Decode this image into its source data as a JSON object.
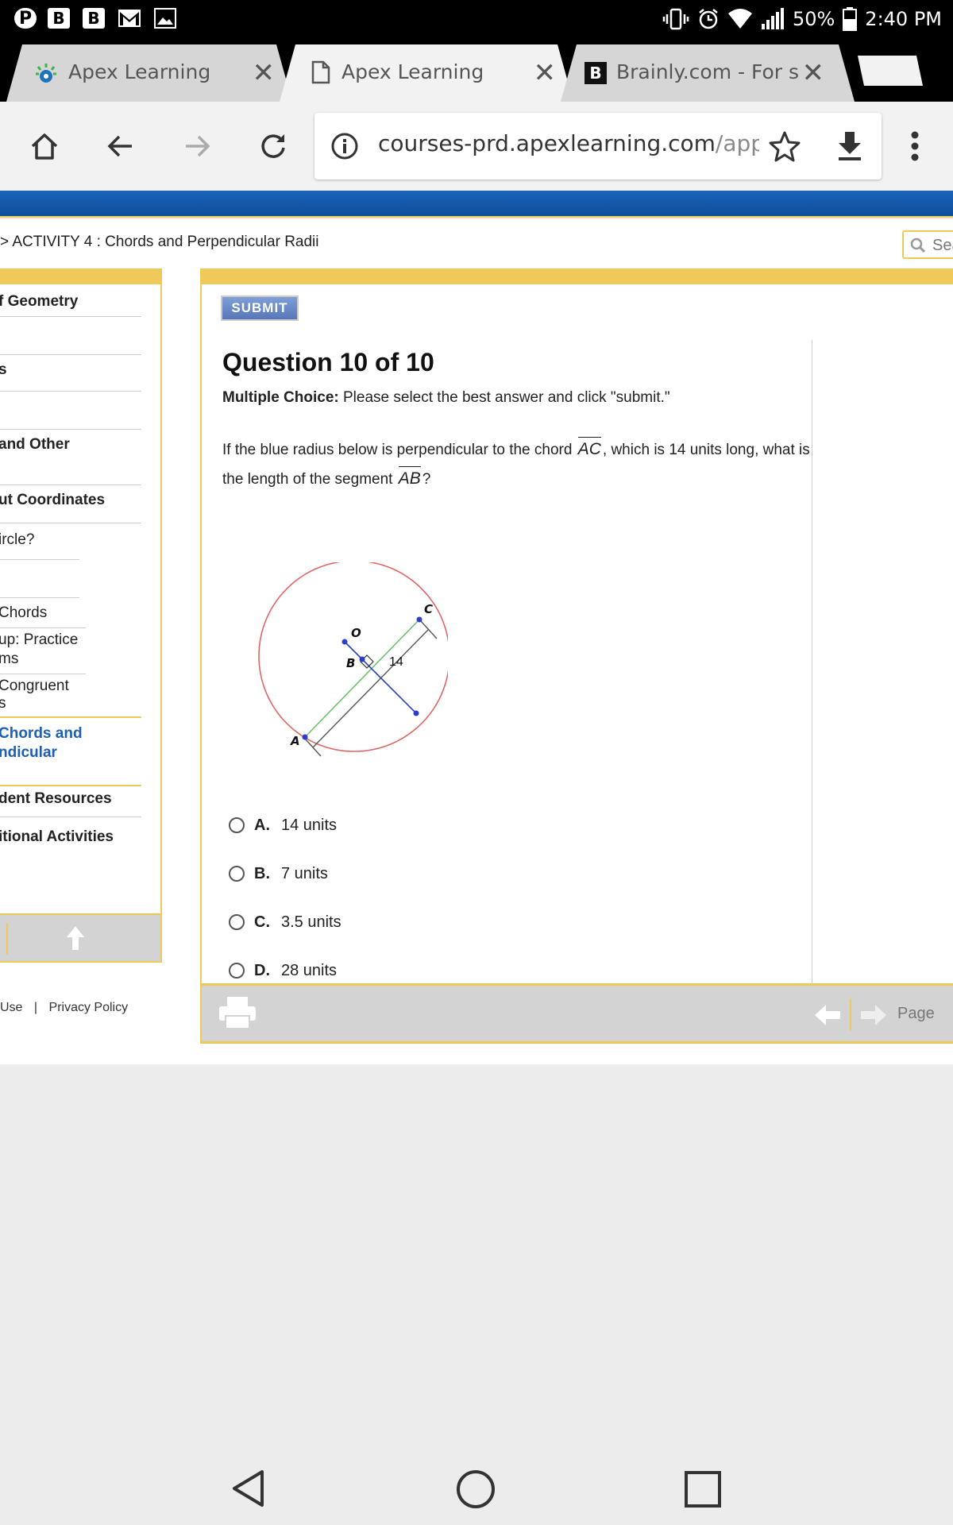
{
  "status_bar": {
    "notification_icons": [
      "pinterest-icon",
      "brainly-icon",
      "brainly-icon",
      "gmail-icon",
      "gallery-icon"
    ],
    "notif_b1": "B",
    "notif_b2": "B",
    "battery": "50%",
    "time": "2:40 PM"
  },
  "tabs": [
    {
      "label": "Apex Learning",
      "active": false
    },
    {
      "label": "Apex Learning",
      "active": true
    },
    {
      "label": "Brainly.com - For s",
      "active": false
    }
  ],
  "toolbar": {
    "url_host": "courses-prd.apexlearning.com",
    "url_path": "/apps."
  },
  "breadcrumb": "> ACTIVITY 4 : Chords and Perpendicular Radii",
  "search_placeholder": "Sea",
  "left_nav": {
    "items": [
      "f Geometry",
      "s",
      " and Other",
      "ut Coordinates",
      "ircle?",
      "Chords",
      "up: Practice",
      "ms",
      "Congruent",
      "s",
      "Chords and",
      "ndicular",
      "dent Resources",
      "itional Activities"
    ]
  },
  "footer_links": {
    "use": "Use",
    "separator": "|",
    "privacy": "Privacy Policy"
  },
  "question": {
    "submit_label": "SUBMIT",
    "title": "Question 10 of 10",
    "instruction_bold": "Multiple Choice:",
    "instruction_rest": " Please select the best answer and click \"submit.\"",
    "text_part1": "If the blue radius below is perpendicular to the chord ",
    "seg1": "AC",
    "text_part2": ", which is 14 units long, what is the length of the segment ",
    "seg2": "AB",
    "text_part3": "?",
    "diagram": {
      "label_a": "A",
      "label_b": "B",
      "label_c": "C",
      "label_o": "O",
      "length_label": "14"
    },
    "choices": [
      {
        "letter": "A.",
        "text": "14 units"
      },
      {
        "letter": "B.",
        "text": "7 units"
      },
      {
        "letter": "C.",
        "text": "3.5 units"
      },
      {
        "letter": "D.",
        "text": "28 units"
      }
    ]
  },
  "bottom_bar": {
    "page_label": "Page"
  },
  "colors": {
    "accent_yellow": "#f0c95b",
    "header_blue": "#1a64b8",
    "active_nav": "#1c5fb3",
    "circle": "#e06666",
    "chord": "#6ec16e",
    "radius": "#2b3dcf"
  }
}
